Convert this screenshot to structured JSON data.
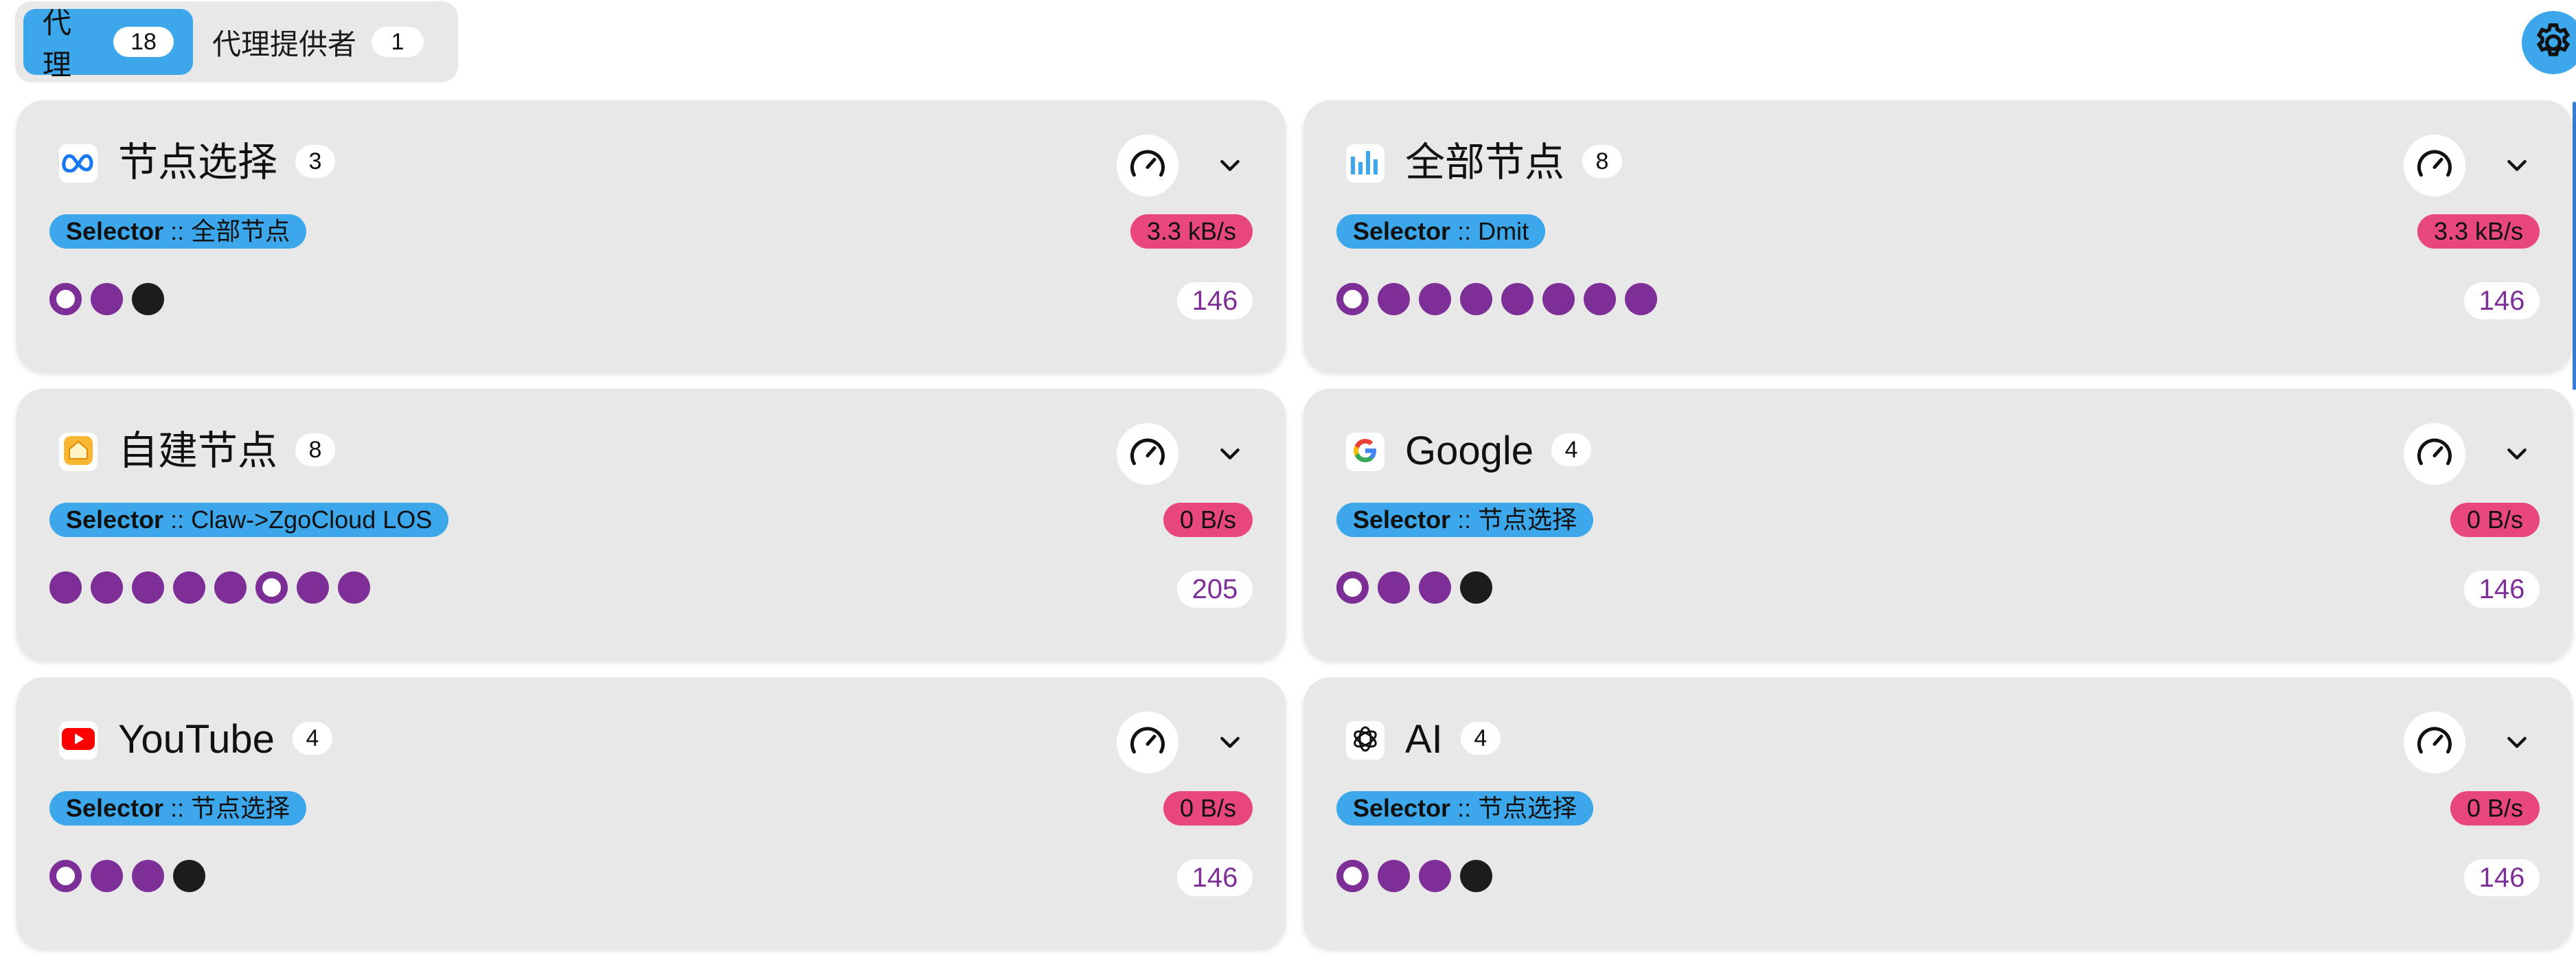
{
  "tabs": [
    {
      "label": "代理",
      "count": "18",
      "active": true
    },
    {
      "label": "代理提供者",
      "count": "1",
      "active": false
    }
  ],
  "settings_icon": "gear-icon",
  "groups": [
    {
      "title": "节点选择",
      "count": "3",
      "icon": "meta-logo-icon",
      "type": "Selector",
      "now": "全部节点",
      "rate": "3.3 kB/s",
      "delay": "146",
      "dots": [
        "selected",
        "alive",
        "dead"
      ]
    },
    {
      "title": "全部节点",
      "count": "8",
      "icon": "bar-chart-icon",
      "type": "Selector",
      "now": "Dmit",
      "rate": "3.3 kB/s",
      "delay": "146",
      "dots": [
        "selected",
        "alive",
        "alive",
        "alive",
        "alive",
        "alive",
        "alive",
        "alive"
      ]
    },
    {
      "title": "自建节点",
      "count": "8",
      "icon": "home-icon",
      "type": "Selector",
      "now": "Claw->ZgoCloud LOS",
      "rate": "0 B/s",
      "delay": "205",
      "dots": [
        "alive",
        "alive",
        "alive",
        "alive",
        "alive",
        "selected",
        "alive",
        "alive"
      ]
    },
    {
      "title": "Google",
      "count": "4",
      "icon": "google-icon",
      "type": "Selector",
      "now": "节点选择",
      "rate": "0 B/s",
      "delay": "146",
      "dots": [
        "selected",
        "alive",
        "alive",
        "dead"
      ]
    },
    {
      "title": "YouTube",
      "count": "4",
      "icon": "youtube-icon",
      "type": "Selector",
      "now": "节点选择",
      "rate": "0 B/s",
      "delay": "146",
      "dots": [
        "selected",
        "alive",
        "alive",
        "dead"
      ]
    },
    {
      "title": "AI",
      "count": "4",
      "icon": "openai-icon",
      "type": "Selector",
      "now": "节点选择",
      "rate": "0 B/s",
      "delay": "146",
      "dots": [
        "selected",
        "alive",
        "alive",
        "dead"
      ]
    }
  ],
  "separator": " :: ",
  "colors": {
    "accent": "#3ca7ea",
    "rate": "#e8467f",
    "node": "#7e2f97",
    "dead": "#1c1c1c",
    "card": "#e8e8e8"
  }
}
